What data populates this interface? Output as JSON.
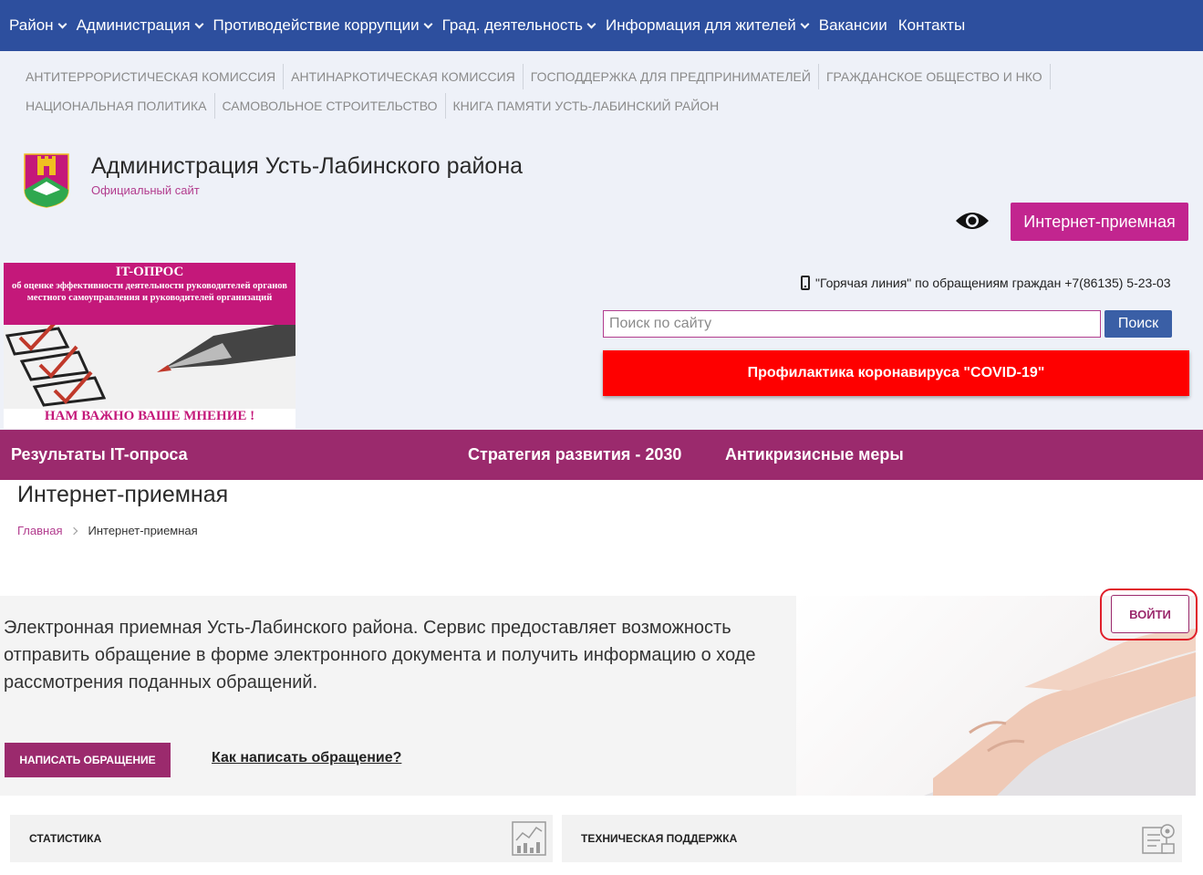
{
  "topnav": {
    "items": [
      {
        "label": "Район",
        "dropdown": true
      },
      {
        "label": "Администрация",
        "dropdown": true
      },
      {
        "label": "Противодействие коррупции",
        "dropdown": true
      },
      {
        "label": "Град. деятельность",
        "dropdown": true
      },
      {
        "label": "Информация для жителей",
        "dropdown": true
      },
      {
        "label": "Вакансии",
        "dropdown": false
      },
      {
        "label": "Контакты",
        "dropdown": false
      }
    ]
  },
  "subnav": {
    "items": [
      "АНТИТЕРРОРИСТИЧЕСКАЯ КОМИССИЯ",
      "АНТИНАРКОТИЧЕСКАЯ КОМИССИЯ",
      "ГОСПОДДЕРЖКА ДЛЯ ПРЕДПРИНИМАТЕЛЕЙ",
      "ГРАЖДАНСКОЕ ОБЩЕСТВО И НКО",
      "НАЦИОНАЛЬНАЯ ПОЛИТИКА",
      "САМОВОЛЬНОЕ СТРОИТЕЛЬСТВО",
      "КНИГА ПАМЯТИ УСТЬ-ЛАБИНСКИЙ РАЙОН"
    ]
  },
  "site": {
    "title": "Администрация Усть-Лабинского района",
    "subtitle": "Официальный сайт"
  },
  "header": {
    "reception_button": "Интернет-приемная",
    "hotline": "\"Горячая линия\" по обращениям граждан +7(86135) 5-23-03",
    "search_placeholder": "Поиск по сайту",
    "search_button": "Поиск",
    "covid_button": "Профилактика коронавируса \"COVID-19\""
  },
  "banner": {
    "title": "IT-ОПРОС",
    "description": "об оценке эффективности деятельности руководителей органов местного самоуправления и руководителей организаций",
    "footer": "НАМ ВАЖНО ВАШЕ МНЕНИЕ !"
  },
  "purplebar": {
    "items": [
      "Результаты IT-опроса",
      "Стратегия развития - 2030",
      "Антикризисные меры"
    ]
  },
  "page": {
    "title": "Интернет-приемная",
    "breadcrumb_home": "Главная",
    "breadcrumb_current": "Интернет-приемная"
  },
  "info": {
    "description": "Электронная приемная Усть-Лабинского района. Сервис предоставляет возможность отправить обращение в форме электронного документа и получить информацию о ходе рассмотрения поданных обращений.",
    "write_button": "НАПИСАТЬ ОБРАЩЕНИЕ",
    "how_link": "Как написать обращение?",
    "login_button": "ВОЙТИ"
  },
  "cards": {
    "statistics": "СТАТИСТИКА",
    "support": "ТЕХНИЧЕСКАЯ ПОДДЕРЖКА"
  },
  "colors": {
    "nav_blue": "#2d4f9e",
    "brand_magenta": "#c2258f",
    "purple_bar": "#9b2a6d",
    "covid_red": "#fe0000",
    "header_bg": "#eef1f8"
  }
}
